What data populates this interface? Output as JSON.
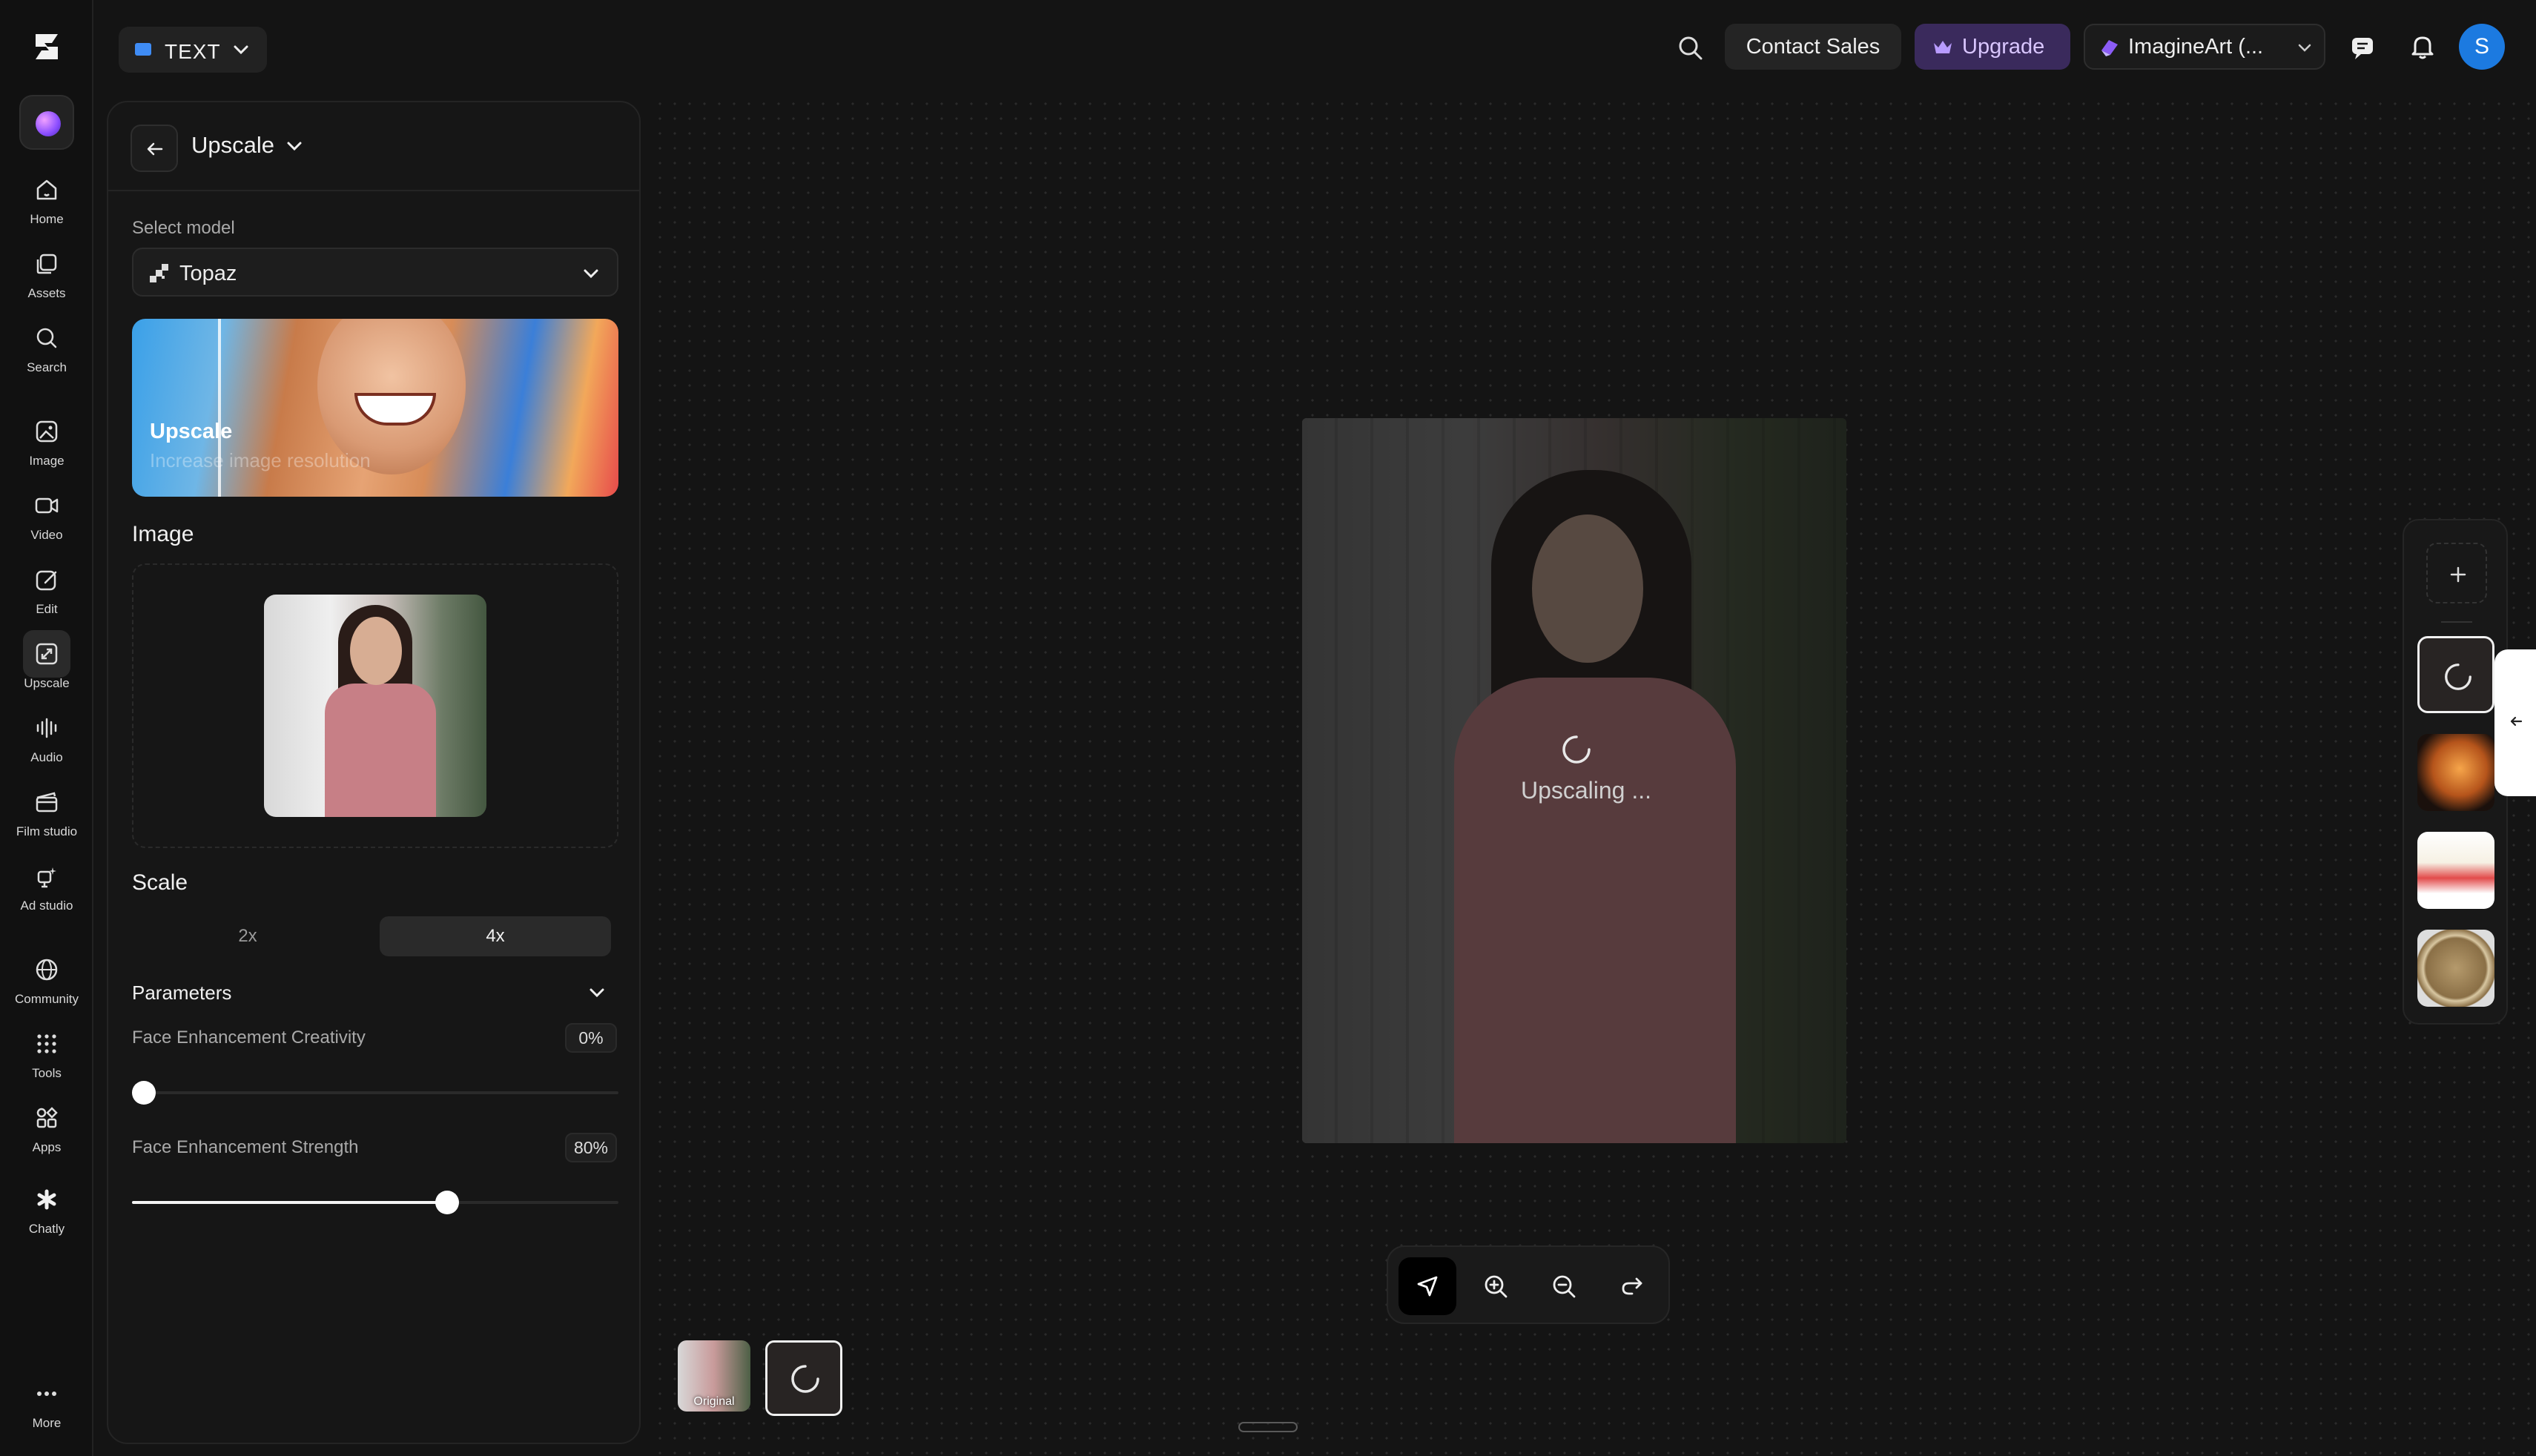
{
  "nav": {
    "items": [
      {
        "label": "Home",
        "icon": "home-icon"
      },
      {
        "label": "Assets",
        "icon": "assets-icon"
      },
      {
        "label": "Search",
        "icon": "search-icon"
      },
      {
        "label": "Image",
        "icon": "image-icon"
      },
      {
        "label": "Video",
        "icon": "video-icon"
      },
      {
        "label": "Edit",
        "icon": "edit-icon"
      },
      {
        "label": "Upscale",
        "icon": "upscale-icon"
      },
      {
        "label": "Audio",
        "icon": "audio-icon"
      },
      {
        "label": "Film studio",
        "icon": "film-studio-icon"
      },
      {
        "label": "Ad studio",
        "icon": "ad-studio-icon"
      },
      {
        "label": "Community",
        "icon": "globe-icon"
      },
      {
        "label": "Tools",
        "icon": "grid-icon"
      },
      {
        "label": "Apps",
        "icon": "apps-icon"
      },
      {
        "label": "Chatly",
        "icon": "chatly-icon"
      },
      {
        "label": "More",
        "icon": "more-icon"
      }
    ],
    "active": "Upscale"
  },
  "header": {
    "project_label": "TEXT",
    "contact_sales": "Contact Sales",
    "upgrade": "Upgrade",
    "workspace": "ImagineArt (...",
    "user_initial": "S",
    "accent_color": "#1c7ae0",
    "upgrade_color": "#3a2a5c"
  },
  "panel": {
    "title": "Upscale",
    "select_model_label": "Select model",
    "model": "Topaz",
    "banner_title": "Upscale",
    "banner_subtitle": "Increase image resolution",
    "image_label": "Image",
    "scale_label": "Scale",
    "scale_options": [
      "2x",
      "4x"
    ],
    "scale_selected": "4x",
    "parameters_label": "Parameters",
    "sliders": [
      {
        "label": "Face Enhancement Creativity",
        "value": "0%",
        "fraction": 0.0
      },
      {
        "label": "Face Enhancement Strength",
        "value": "80%",
        "fraction": 0.8
      }
    ]
  },
  "canvas": {
    "status": "Upscaling ...",
    "history": [
      {
        "label": "Original"
      },
      {
        "label": ""
      }
    ]
  }
}
